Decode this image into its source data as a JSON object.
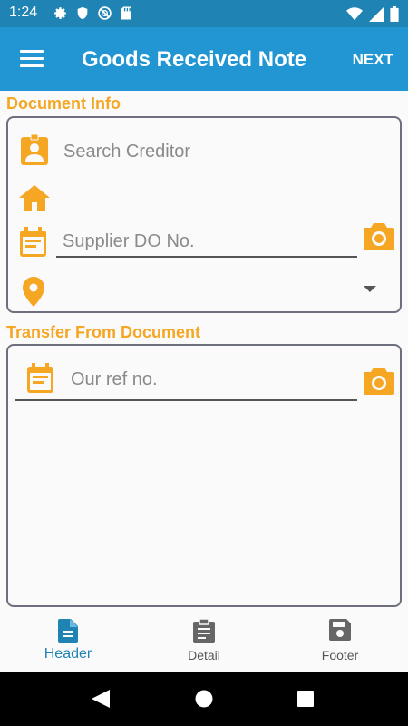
{
  "status_bar": {
    "time": "1:24",
    "icons_left": [
      "gear-icon",
      "shield-icon",
      "no-disturb-icon",
      "sd-card-icon"
    ],
    "icons_right": [
      "wifi-icon",
      "signal-icon",
      "battery-icon"
    ]
  },
  "app_bar": {
    "title": "Goods Received Note",
    "next_label": "NEXT",
    "menu_icon": "menu-icon"
  },
  "document_info": {
    "title": "Document Info",
    "search_creditor_placeholder": "Search Creditor",
    "supplier_do_placeholder": "Supplier DO No.",
    "address_value": "",
    "location_value": ""
  },
  "transfer": {
    "title": "Transfer From Document",
    "our_ref_placeholder": "Our ref no."
  },
  "bottom_nav": {
    "items": [
      {
        "label": "Header",
        "icon": "document-icon",
        "active": true
      },
      {
        "label": "Detail",
        "icon": "clipboard-icon",
        "active": false
      },
      {
        "label": "Footer",
        "icon": "save-icon",
        "active": false
      }
    ]
  },
  "colors": {
    "status_bar": "#1f83b3",
    "app_bar": "#2196d3",
    "accent": "#f5a623",
    "border": "#6d6f7e"
  }
}
